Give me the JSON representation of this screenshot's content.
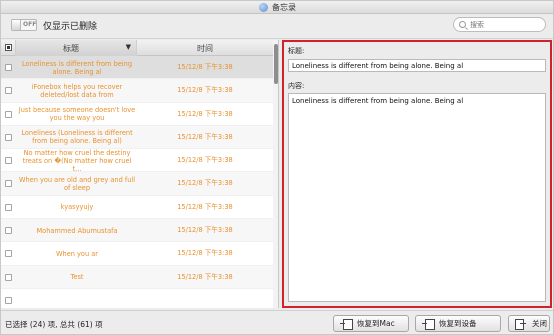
{
  "window": {
    "title": "备忘录"
  },
  "toolbar": {
    "toggle_state": "OFF",
    "toggle_label": "仅显示已删除",
    "search_placeholder": "搜索"
  },
  "list": {
    "columns": {
      "title": "标题",
      "time": "时间"
    },
    "rows": [
      {
        "title": "Loneliness is different from being alone. Being al",
        "time": "15/12/8 下午3:38",
        "selected": true
      },
      {
        "title": "iFonebox helps you recover deleted/lost data from",
        "time": "15/12/8 下午3:38",
        "selected": false
      },
      {
        "title": "Just because someone doesn't love you the way you",
        "time": "15/12/8 下午3:38",
        "selected": false
      },
      {
        "title": "Loneliness (Loneliness is different from being alone. Being al)",
        "time": "15/12/8 下午3:38",
        "selected": false
      },
      {
        "title": "No matter how cruel the destiny treats on �(No matter how cruel t...",
        "time": "15/12/8 下午3:38",
        "selected": false
      },
      {
        "title": "When you are old and grey and full of sleep",
        "time": "15/12/8 下午3:38",
        "selected": false
      },
      {
        "title": "kyasyyujy",
        "time": "15/12/8 下午3:38",
        "selected": false
      },
      {
        "title": "Mohammed Abumustafa",
        "time": "15/12/8 下午3:38",
        "selected": false
      },
      {
        "title": "When you ar",
        "time": "15/12/8 下午3:38",
        "selected": false
      },
      {
        "title": "Test",
        "time": "15/12/8 下午3:38",
        "selected": false
      },
      {
        "title": "",
        "time": "",
        "selected": false
      }
    ]
  },
  "detail": {
    "title_label": "标题:",
    "title_value": "Loneliness is different from being alone. Being al",
    "content_label": "内容:",
    "content_value": "Loneliness is different from being alone. Being al"
  },
  "status": {
    "text": "已选择 (24) 项, 总共 (61) 项",
    "restore_mac": "恢复到Mac",
    "restore_device": "恢复到设备",
    "close": "关闭"
  },
  "colors": {
    "accent_text": "#e8912d",
    "highlight_border": "#d4202a"
  }
}
